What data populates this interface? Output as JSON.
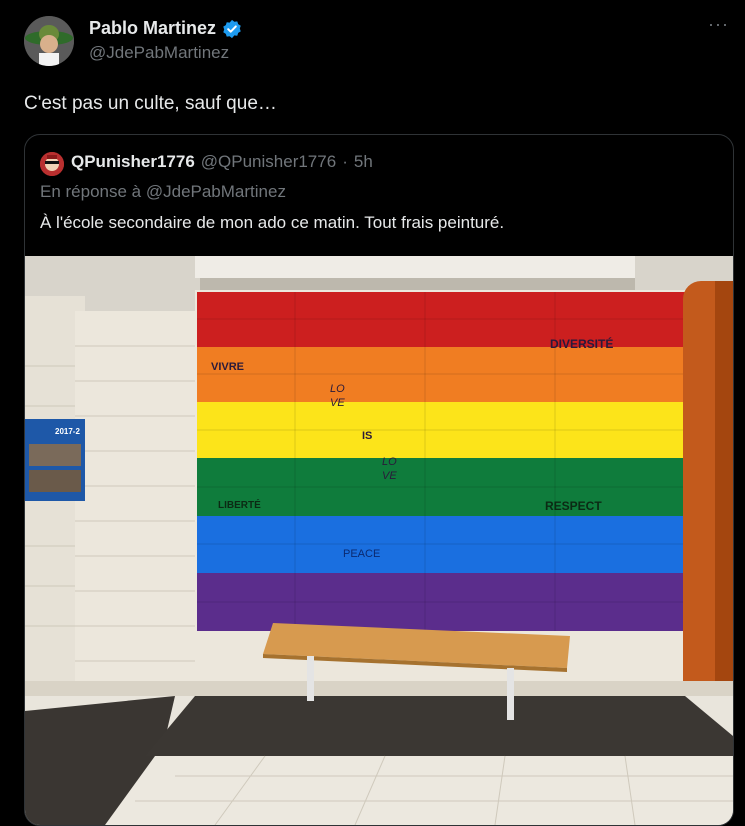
{
  "author": {
    "name": "Pablo Martinez",
    "handle": "@JdePabMartinez",
    "verified_icon": "verified-badge-icon",
    "avatar_icon": "avatar"
  },
  "more_label": "···",
  "tweet_text": "C'est pas un culte, sauf que…",
  "quote": {
    "name": "QPunisher1776",
    "handle": "@QPunisher1776",
    "separator": "·",
    "time": "5h",
    "reply_to": "En réponse à @JdePabMartinez",
    "text": "À l'école secondaire de mon ado ce matin. Tout frais peinturé.",
    "photo": {
      "wall_words": {
        "vivre": "VIVRE",
        "diversite": "DIVERSITÉ",
        "love1a": "LO",
        "love1b": "VE",
        "is": "IS",
        "love2a": "LO",
        "love2b": "VE",
        "liberte": "LIBERTÉ",
        "respect": "RESPECT",
        "peace": "PEACE",
        "poster": "2017-2"
      },
      "stripe_colors": [
        "#cc1f1f",
        "#f07d22",
        "#fce41a",
        "#0f7c3c",
        "#1a6fe0",
        "#5b2d8c"
      ]
    }
  },
  "colors": {
    "background": "#000000",
    "text": "#e7e9ea",
    "secondary": "#71767b",
    "verified": "#1d9bf0"
  }
}
